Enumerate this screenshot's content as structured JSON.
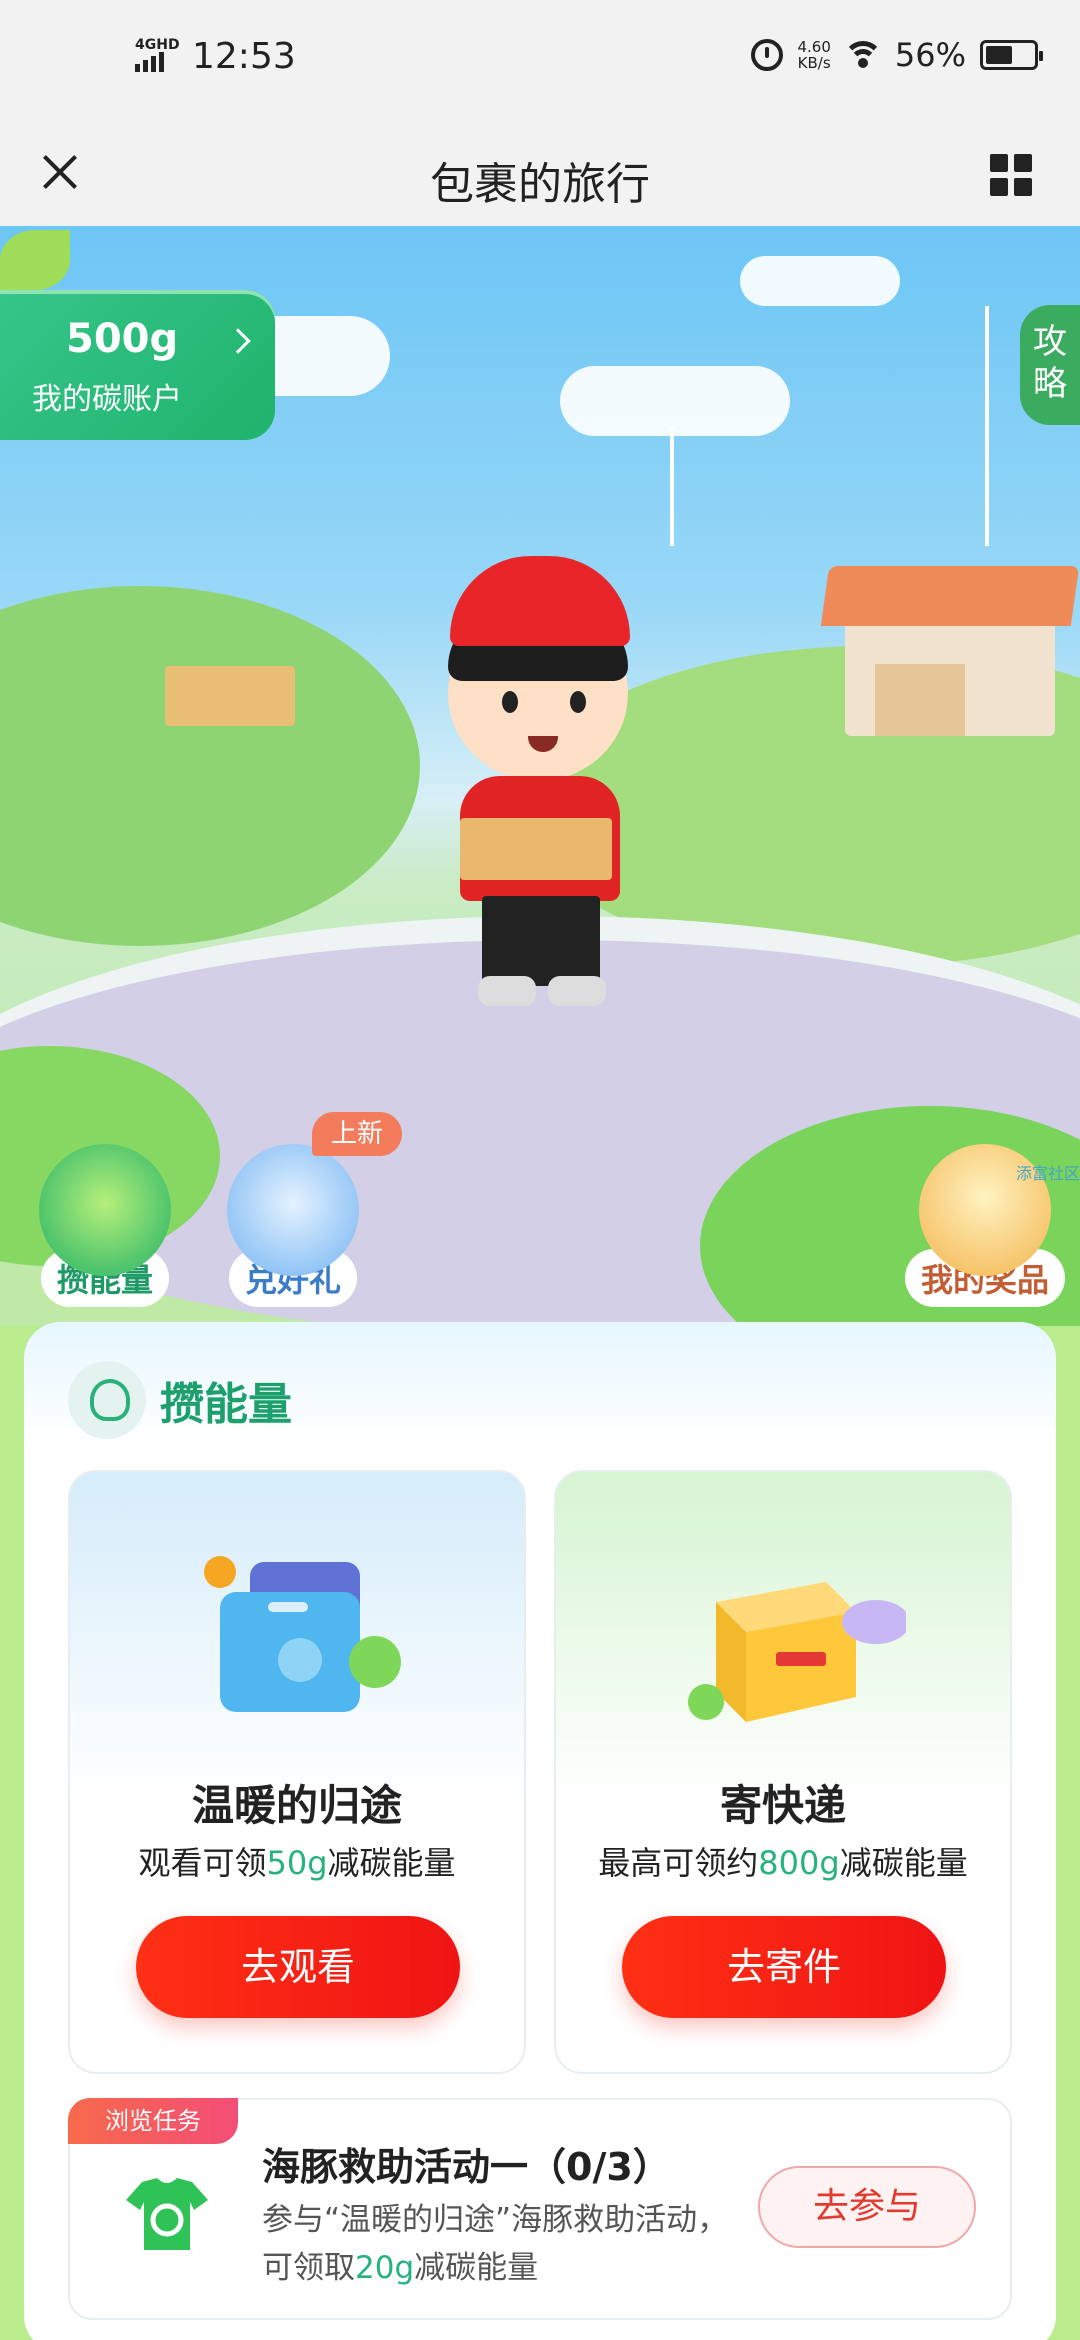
{
  "status_bar": {
    "network": "4GHD",
    "time": "12:53",
    "net_speed_value": "4.60",
    "net_speed_unit": "KB/s",
    "battery_percent": "56%",
    "battery_level": 0.56
  },
  "nav": {
    "title": "包裹的旅行",
    "close_icon": "close-icon",
    "menu_icon": "grid-menu-icon"
  },
  "hero": {
    "carbon_amount": "500g",
    "carbon_label": "我的碳账户",
    "strategy_tab": [
      "攻",
      "略"
    ],
    "buttons": {
      "collect_energy": "攒能量",
      "redeem_gift": "兑好礼",
      "new_badge": "上新",
      "my_prizes": "我的奖品"
    },
    "caption": "添富社区"
  },
  "panel": {
    "title": "攒能量",
    "cards": [
      {
        "title": "温暖的归途",
        "desc_prefix": "观看可领",
        "desc_highlight": "50g",
        "desc_suffix": "减碳能量",
        "button": "去观看"
      },
      {
        "title": "寄快递",
        "desc_prefix": "最高可领约",
        "desc_highlight": "800g",
        "desc_suffix": "减碳能量",
        "button": "去寄件"
      }
    ],
    "task": {
      "tag": "浏览任务",
      "title": "海豚救助活动一（0/3）",
      "desc_prefix": "参与“温暖的归途”海豚救助活动，可领取",
      "desc_highlight": "20g",
      "desc_suffix": "减碳能量",
      "button": "去参与"
    }
  },
  "colors": {
    "accent_green": "#1ea06d",
    "button_red": "#ff3014",
    "highlight_green": "#27b37e"
  }
}
